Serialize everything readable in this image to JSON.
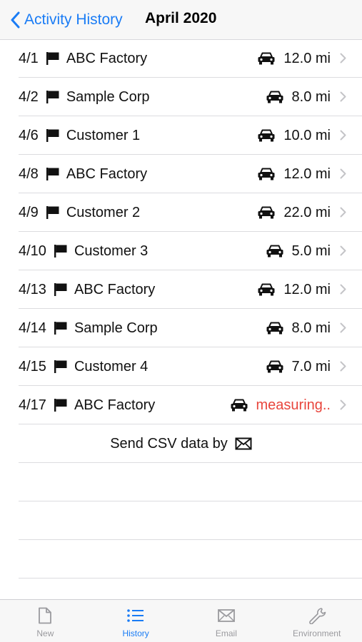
{
  "header": {
    "back_label": "Activity History",
    "title": "April 2020"
  },
  "rows": [
    {
      "date": "4/1",
      "place": "ABC Factory",
      "distance": "12.0 mi"
    },
    {
      "date": "4/2",
      "place": "Sample Corp",
      "distance": "8.0 mi"
    },
    {
      "date": "4/6",
      "place": "Customer 1",
      "distance": "10.0 mi"
    },
    {
      "date": "4/8",
      "place": "ABC Factory",
      "distance": "12.0 mi"
    },
    {
      "date": "4/9",
      "place": "Customer 2",
      "distance": "22.0 mi"
    },
    {
      "date": "4/10",
      "place": "Customer 3",
      "distance": "5.0 mi"
    },
    {
      "date": "4/13",
      "place": "ABC Factory",
      "distance": "12.0 mi"
    },
    {
      "date": "4/14",
      "place": "Sample Corp",
      "distance": "8.0 mi"
    },
    {
      "date": "4/15",
      "place": "Customer 4",
      "distance": "7.0 mi"
    },
    {
      "date": "4/17",
      "place": "ABC Factory",
      "distance": "measuring..",
      "status": "measuring"
    }
  ],
  "csv": {
    "label": "Send CSV data by",
    "icon": "envelope-icon"
  },
  "tabs": [
    {
      "label": "New",
      "icon": "document-icon",
      "active": false
    },
    {
      "label": "History",
      "icon": "list-icon",
      "active": true
    },
    {
      "label": "Email",
      "icon": "envelope-icon",
      "active": false
    },
    {
      "label": "Environment",
      "icon": "wrench-icon",
      "active": false
    }
  ],
  "colors": {
    "accent": "#1a7cf5",
    "measuring": "#e8453c",
    "inactive": "#9a9a9e"
  }
}
